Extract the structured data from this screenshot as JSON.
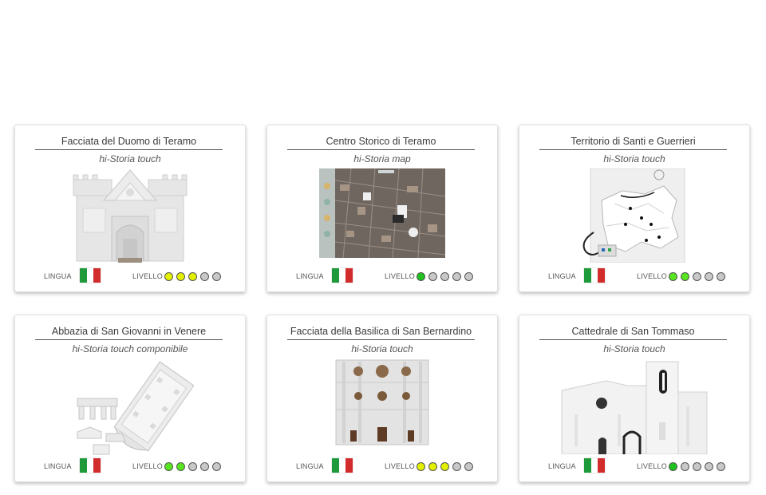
{
  "labels": {
    "lingua": "LINGUA",
    "livello": "LIVELLO"
  },
  "flag_colors": [
    "#1f9a3a",
    "#ffffff",
    "#d22b2b"
  ],
  "cards": [
    {
      "title": "Facciata del Duomo di Teramo",
      "subtitle": "hi-Storia touch",
      "thumbnail": "duomo-teramo-model",
      "level": 3,
      "level_color": "#e3f000"
    },
    {
      "title": "Centro Storico di Teramo",
      "subtitle": "hi-Storia map",
      "thumbnail": "centro-storico-map",
      "level": 1,
      "level_color": "#1fc21f"
    },
    {
      "title": "Territorio di Santi e Guerrieri",
      "subtitle": "hi-Storia touch",
      "thumbnail": "territorio-relief-panel",
      "level": 2,
      "level_color": "#57e51f"
    },
    {
      "title": "Abbazia di San Giovanni in Venere",
      "subtitle": "hi-Storia touch componibile",
      "thumbnail": "abbazia-modular-model",
      "level": 2,
      "level_color": "#57e51f"
    },
    {
      "title": "Facciata della Basilica di San Bernardino",
      "subtitle": "hi-Storia touch",
      "thumbnail": "basilica-facade-model",
      "level": 3,
      "level_color": "#e3f000"
    },
    {
      "title": "Cattedrale di San Tommaso",
      "subtitle": "hi-Storia touch",
      "thumbnail": "cattedrale-model",
      "level": 1,
      "level_color": "#1fc21f"
    }
  ]
}
